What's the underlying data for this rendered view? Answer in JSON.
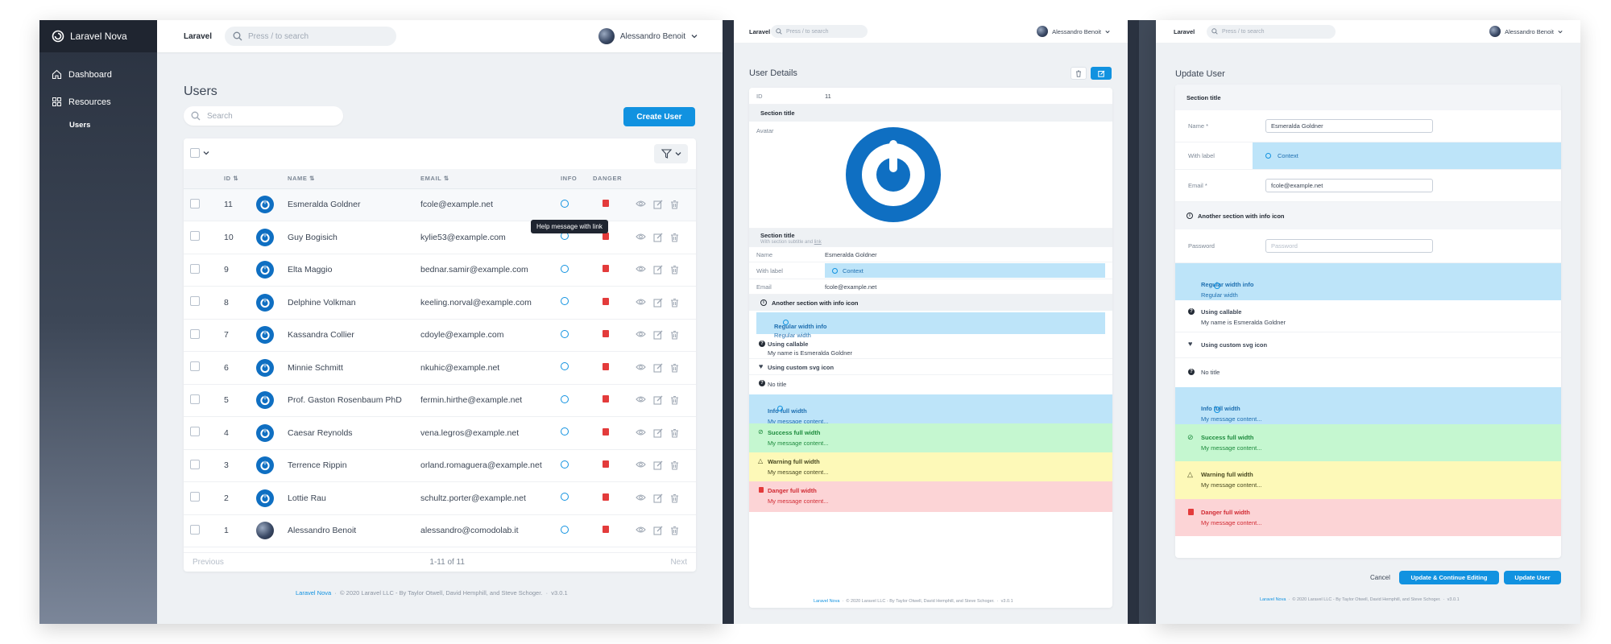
{
  "app": {
    "brand": "Laravel Nova",
    "header_brand": "Laravel",
    "search_placeholder": "Press / to search",
    "user_name": "Alessandro Benoit"
  },
  "sidebar": {
    "items": [
      {
        "label": "Dashboard"
      },
      {
        "label": "Resources"
      }
    ],
    "subitems": [
      {
        "label": "Users"
      }
    ]
  },
  "users_page": {
    "title": "Users",
    "search_placeholder": "Search",
    "create_button": "Create User",
    "columns": [
      "ID",
      "NAME",
      "EMAIL",
      "INFO",
      "DANGER"
    ],
    "rows": [
      {
        "id": "11",
        "name": "Esmeralda Goldner",
        "email": "fcole@example.net"
      },
      {
        "id": "10",
        "name": "Guy Bogisich",
        "email": "kylie53@example.com"
      },
      {
        "id": "9",
        "name": "Elta Maggio",
        "email": "bednar.samir@example.com"
      },
      {
        "id": "8",
        "name": "Delphine Volkman",
        "email": "keeling.norval@example.com"
      },
      {
        "id": "7",
        "name": "Kassandra Collier",
        "email": "cdoyle@example.com"
      },
      {
        "id": "6",
        "name": "Minnie Schmitt",
        "email": "nkuhic@example.net"
      },
      {
        "id": "5",
        "name": "Prof. Gaston Rosenbaum PhD",
        "email": "fermin.hirthe@example.net"
      },
      {
        "id": "4",
        "name": "Caesar Reynolds",
        "email": "vena.legros@example.net"
      },
      {
        "id": "3",
        "name": "Terrence Rippin",
        "email": "orland.romaguera@example.net"
      },
      {
        "id": "2",
        "name": "Lottie Rau",
        "email": "schultz.porter@example.net"
      },
      {
        "id": "1",
        "name": "Alessandro Benoit",
        "email": "alessandro@comodolab.it"
      }
    ],
    "tooltip": "Help message with link",
    "pagination": {
      "previous": "Previous",
      "info": "1-11 of 11",
      "next": "Next"
    }
  },
  "footer": {
    "link": "Laravel Nova",
    "text": "© 2020 Laravel LLC - By Taylor Otwell, David Hemphill, and Steve Schoger.",
    "version": "v3.0.1"
  },
  "detail_page": {
    "title": "User Details",
    "id_label": "ID",
    "id_value": "11",
    "section1": "Section title",
    "avatar_label": "Avatar",
    "section2": "Section title",
    "section2_subtitle": "With section subtitle and",
    "section2_link": "link",
    "name_label": "Name",
    "name_value": "Esmeralda Goldner",
    "with_label": "With label",
    "context": "Context",
    "email_label": "Email",
    "email_value": "fcole@example.net",
    "another_section": "Another section with info icon",
    "regular_info_title": "Regular width info",
    "regular_info_text": "Regular width",
    "callable_title": "Using callable",
    "callable_text": "My name is Esmeralda Goldner",
    "svg_icon_title": "Using custom svg icon",
    "no_title": "No title",
    "info_full": "Info full width",
    "success_full": "Success full width",
    "warning_full": "Warning full width",
    "danger_full": "Danger full width",
    "message": "My message content..."
  },
  "update_page": {
    "title": "Update User",
    "section": "Section title",
    "name_label": "Name *",
    "name_value": "Esmeralda Goldner",
    "with_label": "With label",
    "context": "Context",
    "email_label": "Email *",
    "email_value": "fcole@example.net",
    "another_section": "Another section with info icon",
    "password_label": "Password",
    "password_placeholder": "Password",
    "regular_info_title": "Regular width info",
    "regular_info_text": "Regular width",
    "callable_title": "Using callable",
    "callable_text": "My name is Esmeralda Goldner",
    "svg_icon_title": "Using custom svg icon",
    "no_title": "No title",
    "info_full": "Info full width",
    "success_full": "Success full width",
    "warning_full": "Warning full width",
    "danger_full": "Danger full width",
    "message": "My message content...",
    "cancel": "Cancel",
    "update_continue": "Update & Continue Editing",
    "update": "Update User"
  },
  "colors": {
    "primary": "#1192e0",
    "danger": "#e33b3b",
    "info_bg": "#bde4f9",
    "success_bg": "#c5f7d0",
    "warning_bg": "#fdf9b8",
    "danger_bg": "#fcd4d6"
  }
}
